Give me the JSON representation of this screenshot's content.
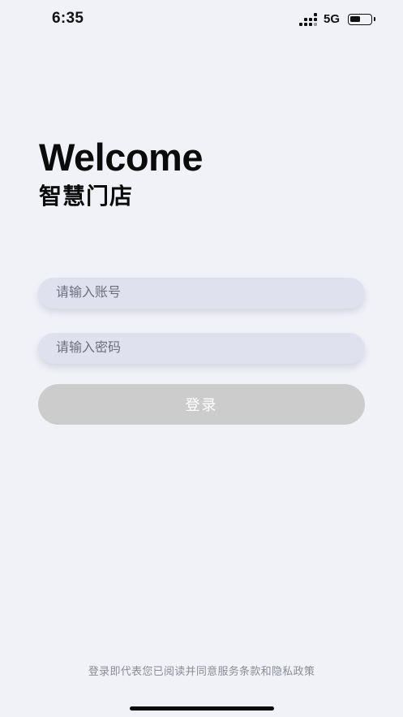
{
  "status_bar": {
    "time": "6:35",
    "network": "5G",
    "battery_level": 0.5,
    "icons": [
      "signal-icon",
      "battery-icon"
    ]
  },
  "header": {
    "title_en": "Welcome",
    "title_cn": "智慧门店"
  },
  "form": {
    "account_placeholder": "请输入账号",
    "account_value": "",
    "password_placeholder": "请输入密码",
    "password_value": "",
    "login_label": "登录"
  },
  "footer": {
    "agreement_text": "登录即代表您已阅读并同意服务条款和隐私政策"
  },
  "colors": {
    "background": "#f1f2f7",
    "input_background": "#dfe1ee",
    "button_disabled": "#cccccc",
    "text_primary": "#0b0b0b",
    "text_muted": "#8a8c96"
  }
}
